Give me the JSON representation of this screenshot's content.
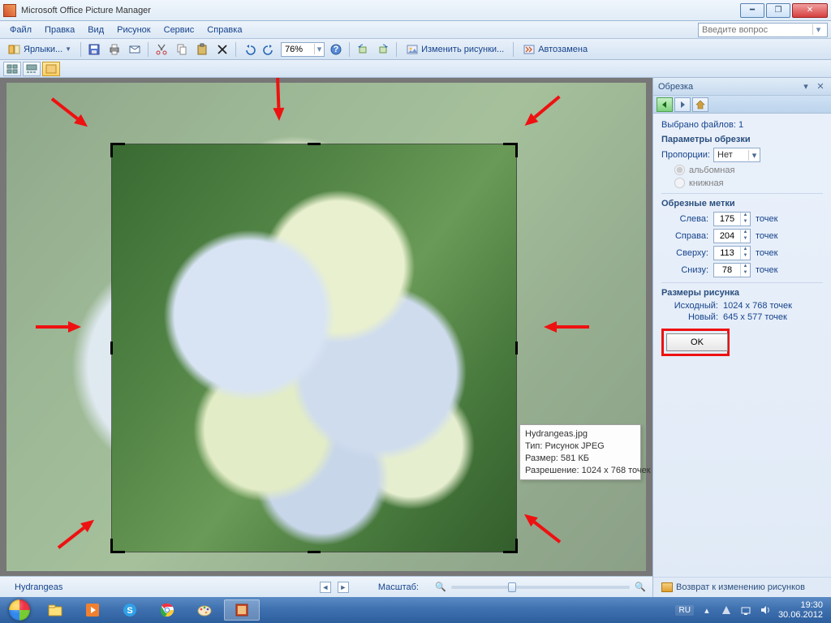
{
  "window": {
    "title": "Microsoft Office Picture Manager"
  },
  "menu": {
    "items": [
      "Файл",
      "Правка",
      "Вид",
      "Рисунок",
      "Сервис",
      "Справка"
    ],
    "ask_placeholder": "Введите вопрос"
  },
  "toolbar": {
    "shortcuts_label": "Ярлыки...",
    "zoom": "76%",
    "edit_pictures": "Изменить рисунки...",
    "auto_correct": "Автозамена"
  },
  "canvas": {
    "filename": "Hydrangeas",
    "zoom_label": "Масштаб:"
  },
  "tooltip": {
    "name": "Hydrangeas.jpg",
    "type": "Тип: Рисунок JPEG",
    "size": "Размер: 581 КБ",
    "dims": "Разрешение: 1024 x 768 точек"
  },
  "panel": {
    "title": "Обрезка",
    "selected": "Выбрано файлов: 1",
    "sect_params": "Параметры обрезки",
    "proportions_label": "Пропорции:",
    "proportions_value": "Нет",
    "orient_landscape": "альбомная",
    "orient_portrait": "книжная",
    "sect_marks": "Обрезные метки",
    "left_label": "Слева:",
    "left_value": "175",
    "right_label": "Справа:",
    "right_value": "204",
    "top_label": "Сверху:",
    "top_value": "113",
    "bottom_label": "Снизу:",
    "bottom_value": "78",
    "unit": "точек",
    "sect_size": "Размеры рисунка",
    "orig_label": "Исходный:",
    "orig_value": "1024 x 768 точек",
    "new_label": "Новый:",
    "new_value": "645 x 577 точек",
    "ok": "OK",
    "back_link": "Возврат к изменению рисунков"
  },
  "taskbar": {
    "lang": "RU",
    "time": "19:30",
    "date": "30.06.2012"
  }
}
